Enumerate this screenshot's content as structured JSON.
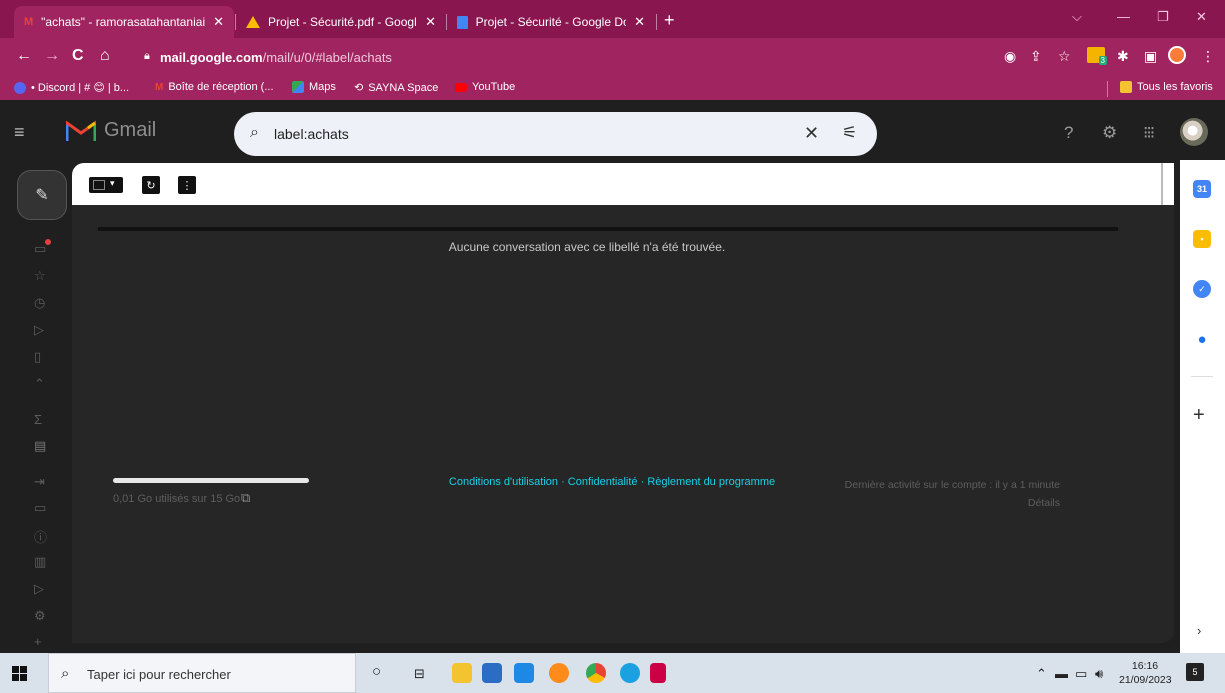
{
  "browser": {
    "tabs": [
      {
        "title": "\"achats\" - ramorasatahantaniaina",
        "active": true
      },
      {
        "title": "Projet - Sécurité.pdf - Google Dr",
        "active": false
      },
      {
        "title": "Projet - Sécurité - Google Docs",
        "active": false
      }
    ],
    "url_host": "mail.google.com",
    "url_path": "/mail/u/0/#label/achats",
    "bookmarks": [
      {
        "label": "• Discord | # 😊 | b..."
      },
      {
        "label": "Boîte de réception (..."
      },
      {
        "label": "Maps"
      },
      {
        "label": "SAYNA Space"
      },
      {
        "label": "YouTube"
      }
    ],
    "all_bookmarks": "Tous les favoris",
    "extension_badge": "3"
  },
  "gmail": {
    "brand": "Gmail",
    "search_value": "label:achats",
    "empty_message": "Aucune conversation avec ce libellé n'a été trouvée.",
    "storage_text": "0,01 Go utilisés sur 15 Go",
    "storage_fraction": 0.001,
    "footer": {
      "terms": "Conditions d'utilisation",
      "privacy": "Confidentialité",
      "program": "Règlement du programme"
    },
    "activity": "Dernière activité sur le compte : il y a 1 minute",
    "details": "Détails"
  },
  "taskbar": {
    "search_placeholder": "Taper ici pour rechercher",
    "time": "16:16",
    "date": "21/09/2023",
    "notifications": "5"
  },
  "colors": {
    "browser_frame": "#a0245f",
    "link_cyan": "#19d1e6",
    "gmail_bg": "#1f1f1f"
  }
}
